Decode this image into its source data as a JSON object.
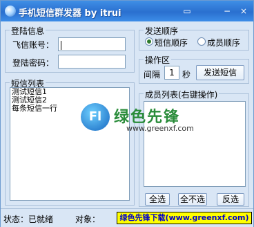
{
  "window": {
    "title": "手机短信群发器 by itrui"
  },
  "login": {
    "group_title": "登陆信息",
    "account_label": "飞信账号：",
    "account_value": "",
    "password_label": "登陆密码：",
    "password_value": ""
  },
  "send_order": {
    "group_title": "发送顺序",
    "options": [
      {
        "label": "短信顺序",
        "checked": true
      },
      {
        "label": "成员顺序",
        "checked": false
      }
    ]
  },
  "operation": {
    "group_title": "操作区",
    "interval_label": "间隔",
    "interval_value": "1",
    "unit_label": "秒",
    "send_button": "发送短信"
  },
  "sms_list": {
    "group_title": "短信列表",
    "items": [
      "测试短信1",
      "测试短信2",
      "每条短信一行"
    ]
  },
  "member_list": {
    "group_title": "成员列表(右键操作)",
    "buttons": [
      "全选",
      "全不选",
      "反选"
    ]
  },
  "status": {
    "state_label": "状态：已就绪",
    "target_label": "对象："
  },
  "watermark": {
    "logo_text": "Fl",
    "name": "绿色先锋",
    "url": "www.greenxf.com"
  },
  "site_badge": "绿色先锋下载(www.greenxf.com)",
  "colors": {
    "titlebar": "#2a6fcf",
    "window_bg": "#d9e6f5",
    "badge": "#ffff00"
  }
}
